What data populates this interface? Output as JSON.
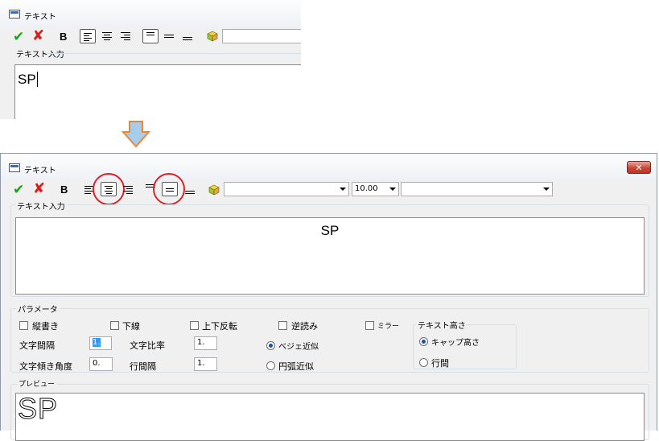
{
  "top": {
    "title": "テキスト",
    "label_text_input": "テキスト入力",
    "input_value": "SP"
  },
  "arrow_color": "#e8893a",
  "dialog": {
    "title": "テキスト",
    "close_label": "✕",
    "toolbar": {
      "ok_glyph": "✔",
      "cancel_glyph": "✘",
      "bold_label": "B",
      "font_combo_value": "",
      "size_combo_value": "10.00",
      "style_combo_value": ""
    },
    "label_text_input": "テキスト入力",
    "input_value": "SP",
    "params": {
      "label": "パラメータ",
      "vertical": "縦書き",
      "underline": "下線",
      "flip": "上下反転",
      "reverse": "逆読み",
      "mirror": "ミラー",
      "char_spacing_label": "文字間隔",
      "char_spacing_value": "1.",
      "char_ratio_label": "文字比率",
      "char_ratio_value": "1.",
      "char_angle_label": "文字傾き角度",
      "char_angle_value": "0.",
      "line_spacing_label": "行間隔",
      "line_spacing_value": "1.",
      "bezier": "ベジェ近似",
      "arc": "円弧近似",
      "height_group_label": "テキスト高さ",
      "cap_height": "キャップ高さ",
      "line_height": "行間"
    },
    "preview": {
      "label": "プレビュー",
      "text": "SP"
    }
  }
}
